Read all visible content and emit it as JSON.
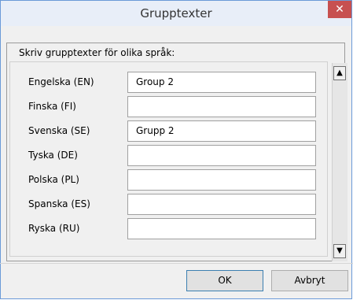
{
  "window": {
    "title": "Grupptexter",
    "close_symbol": "✕"
  },
  "instruction": "Skriv grupptexter för olika språk:",
  "languages": [
    {
      "label": "Engelska (EN)",
      "value": "Group 2"
    },
    {
      "label": "Finska (FI)",
      "value": ""
    },
    {
      "label": "Svenska (SE)",
      "value": "Grupp 2"
    },
    {
      "label": "Tyska (DE)",
      "value": ""
    },
    {
      "label": "Polska (PL)",
      "value": ""
    },
    {
      "label": "Spanska (ES)",
      "value": ""
    },
    {
      "label": "Ryska (RU)",
      "value": ""
    }
  ],
  "scrollbar": {
    "up_symbol": "▲",
    "down_symbol": "▼"
  },
  "buttons": {
    "ok_label": "OK",
    "cancel_label": "Avbryt"
  },
  "colors": {
    "close_button": "#c75050",
    "window_border": "#6b9ad8",
    "dialog_bg": "#f0f0f0"
  }
}
